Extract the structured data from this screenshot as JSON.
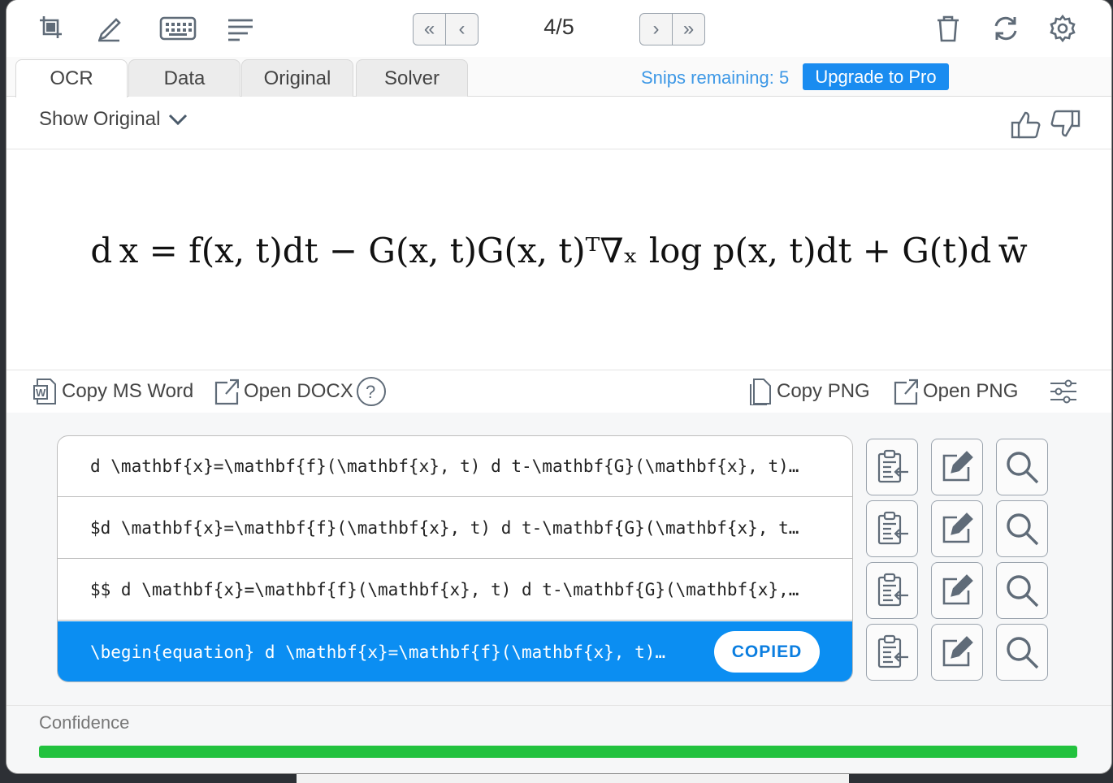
{
  "toolbar": {
    "icons": [
      "crop-icon",
      "handwriting-icon",
      "keyboard-icon",
      "list-icon"
    ],
    "page_indicator": "4/5",
    "nav": {
      "first": "«",
      "prev": "‹",
      "next": "›",
      "last": "»"
    },
    "right_icons": [
      "trash-icon",
      "refresh-icon",
      "gear-icon"
    ]
  },
  "tabs": [
    {
      "label": "OCR",
      "active": true
    },
    {
      "label": "Data",
      "active": false
    },
    {
      "label": "Original",
      "active": false
    },
    {
      "label": "Solver",
      "active": false
    }
  ],
  "snips": {
    "remaining_label": "Snips remaining: 5",
    "upgrade_label": "Upgrade to Pro"
  },
  "show_original": "Show Original",
  "equation": "d x = f(x, t)dt − G(x, t)G(x, t)ᵀ∇ₓ log p(x, t)dt + G(t)d w̄",
  "actions": {
    "copy_word": "Copy MS Word",
    "open_docx": "Open DOCX",
    "copy_png": "Copy PNG",
    "open_png": "Open PNG"
  },
  "formats": [
    {
      "text": "d \\mathbf{x}=\\mathbf{f}(\\mathbf{x}, t) d t-\\mathbf{G}(\\mathbf{x}, t)…",
      "selected": false
    },
    {
      "text": "$d \\mathbf{x}=\\mathbf{f}(\\mathbf{x}, t) d t-\\mathbf{G}(\\mathbf{x}, t…",
      "selected": false
    },
    {
      "text": "$$ d \\mathbf{x}=\\mathbf{f}(\\mathbf{x}, t) d t-\\mathbf{G}(\\mathbf{x},…",
      "selected": false
    },
    {
      "text": "\\begin{equation} d \\mathbf{x}=\\mathbf{f}(\\mathbf{x}, t)…",
      "selected": true,
      "badge": "COPIED"
    }
  ],
  "row_buttons": [
    "paste-icon",
    "edit-icon",
    "search-icon"
  ],
  "confidence": {
    "label": "Confidence",
    "value": 1.0
  },
  "colors": {
    "accent": "#1a8cf0",
    "selected_row": "#0b8ef2",
    "confidence": "#22c23e",
    "link": "#3d98e6"
  }
}
